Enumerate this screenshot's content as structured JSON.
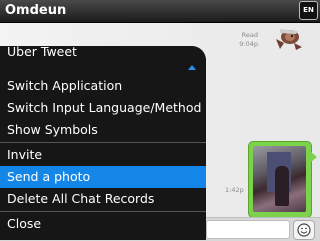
{
  "titlebar": {
    "title": "Omdeun",
    "lang_indicator": "EN"
  },
  "chat": {
    "read_status": "Read",
    "read_time": "9:04p",
    "photo_time": "1:42p"
  },
  "menu": {
    "items": [
      {
        "label": "Uber Tweet"
      },
      {
        "label": "Switch Application"
      },
      {
        "label": "Switch Input Language/Method"
      },
      {
        "label": "Show Symbols"
      },
      {
        "label": "Invite"
      },
      {
        "label": "Send a photo",
        "selected": true
      },
      {
        "label": "Delete All Chat Records"
      },
      {
        "label": "Close"
      }
    ]
  },
  "icons": {
    "scroll_up": "chevron-up-icon",
    "emoticon": "smiley-icon",
    "sticker": "character-sticker-icon"
  },
  "colors": {
    "menu_bg": "#161616",
    "selection": "#1486e8",
    "bubble": "#7cd24a"
  }
}
